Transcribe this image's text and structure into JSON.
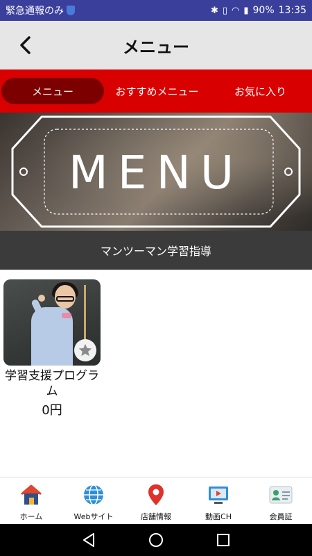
{
  "status_bar": {
    "left_text": "緊急通報のみ",
    "battery": "90%",
    "time": "13:35"
  },
  "header": {
    "title": "メニュー"
  },
  "tabs": [
    {
      "label": "メニュー",
      "active": true
    },
    {
      "label": "おすすめメニュー",
      "active": false
    },
    {
      "label": "お気に入り",
      "active": false
    }
  ],
  "banner": {
    "text": "MENU"
  },
  "section": {
    "title": "マンツーマン学習指導"
  },
  "items": [
    {
      "title": "学習支援プログラム",
      "price": "0円"
    }
  ],
  "bottom_nav": [
    {
      "label": "ホーム",
      "icon": "home-icon"
    },
    {
      "label": "Webサイト",
      "icon": "globe-icon"
    },
    {
      "label": "店舗情報",
      "icon": "map-pin-icon"
    },
    {
      "label": "動画CH",
      "icon": "video-icon"
    },
    {
      "label": "会員証",
      "icon": "member-card-icon"
    }
  ],
  "colors": {
    "status_bar": "#3a3f9c",
    "header_bg": "#e6e6e6",
    "tab_bar": "#d80000",
    "tab_active": "#7d0000",
    "section_bar": "#3b3b3b"
  }
}
